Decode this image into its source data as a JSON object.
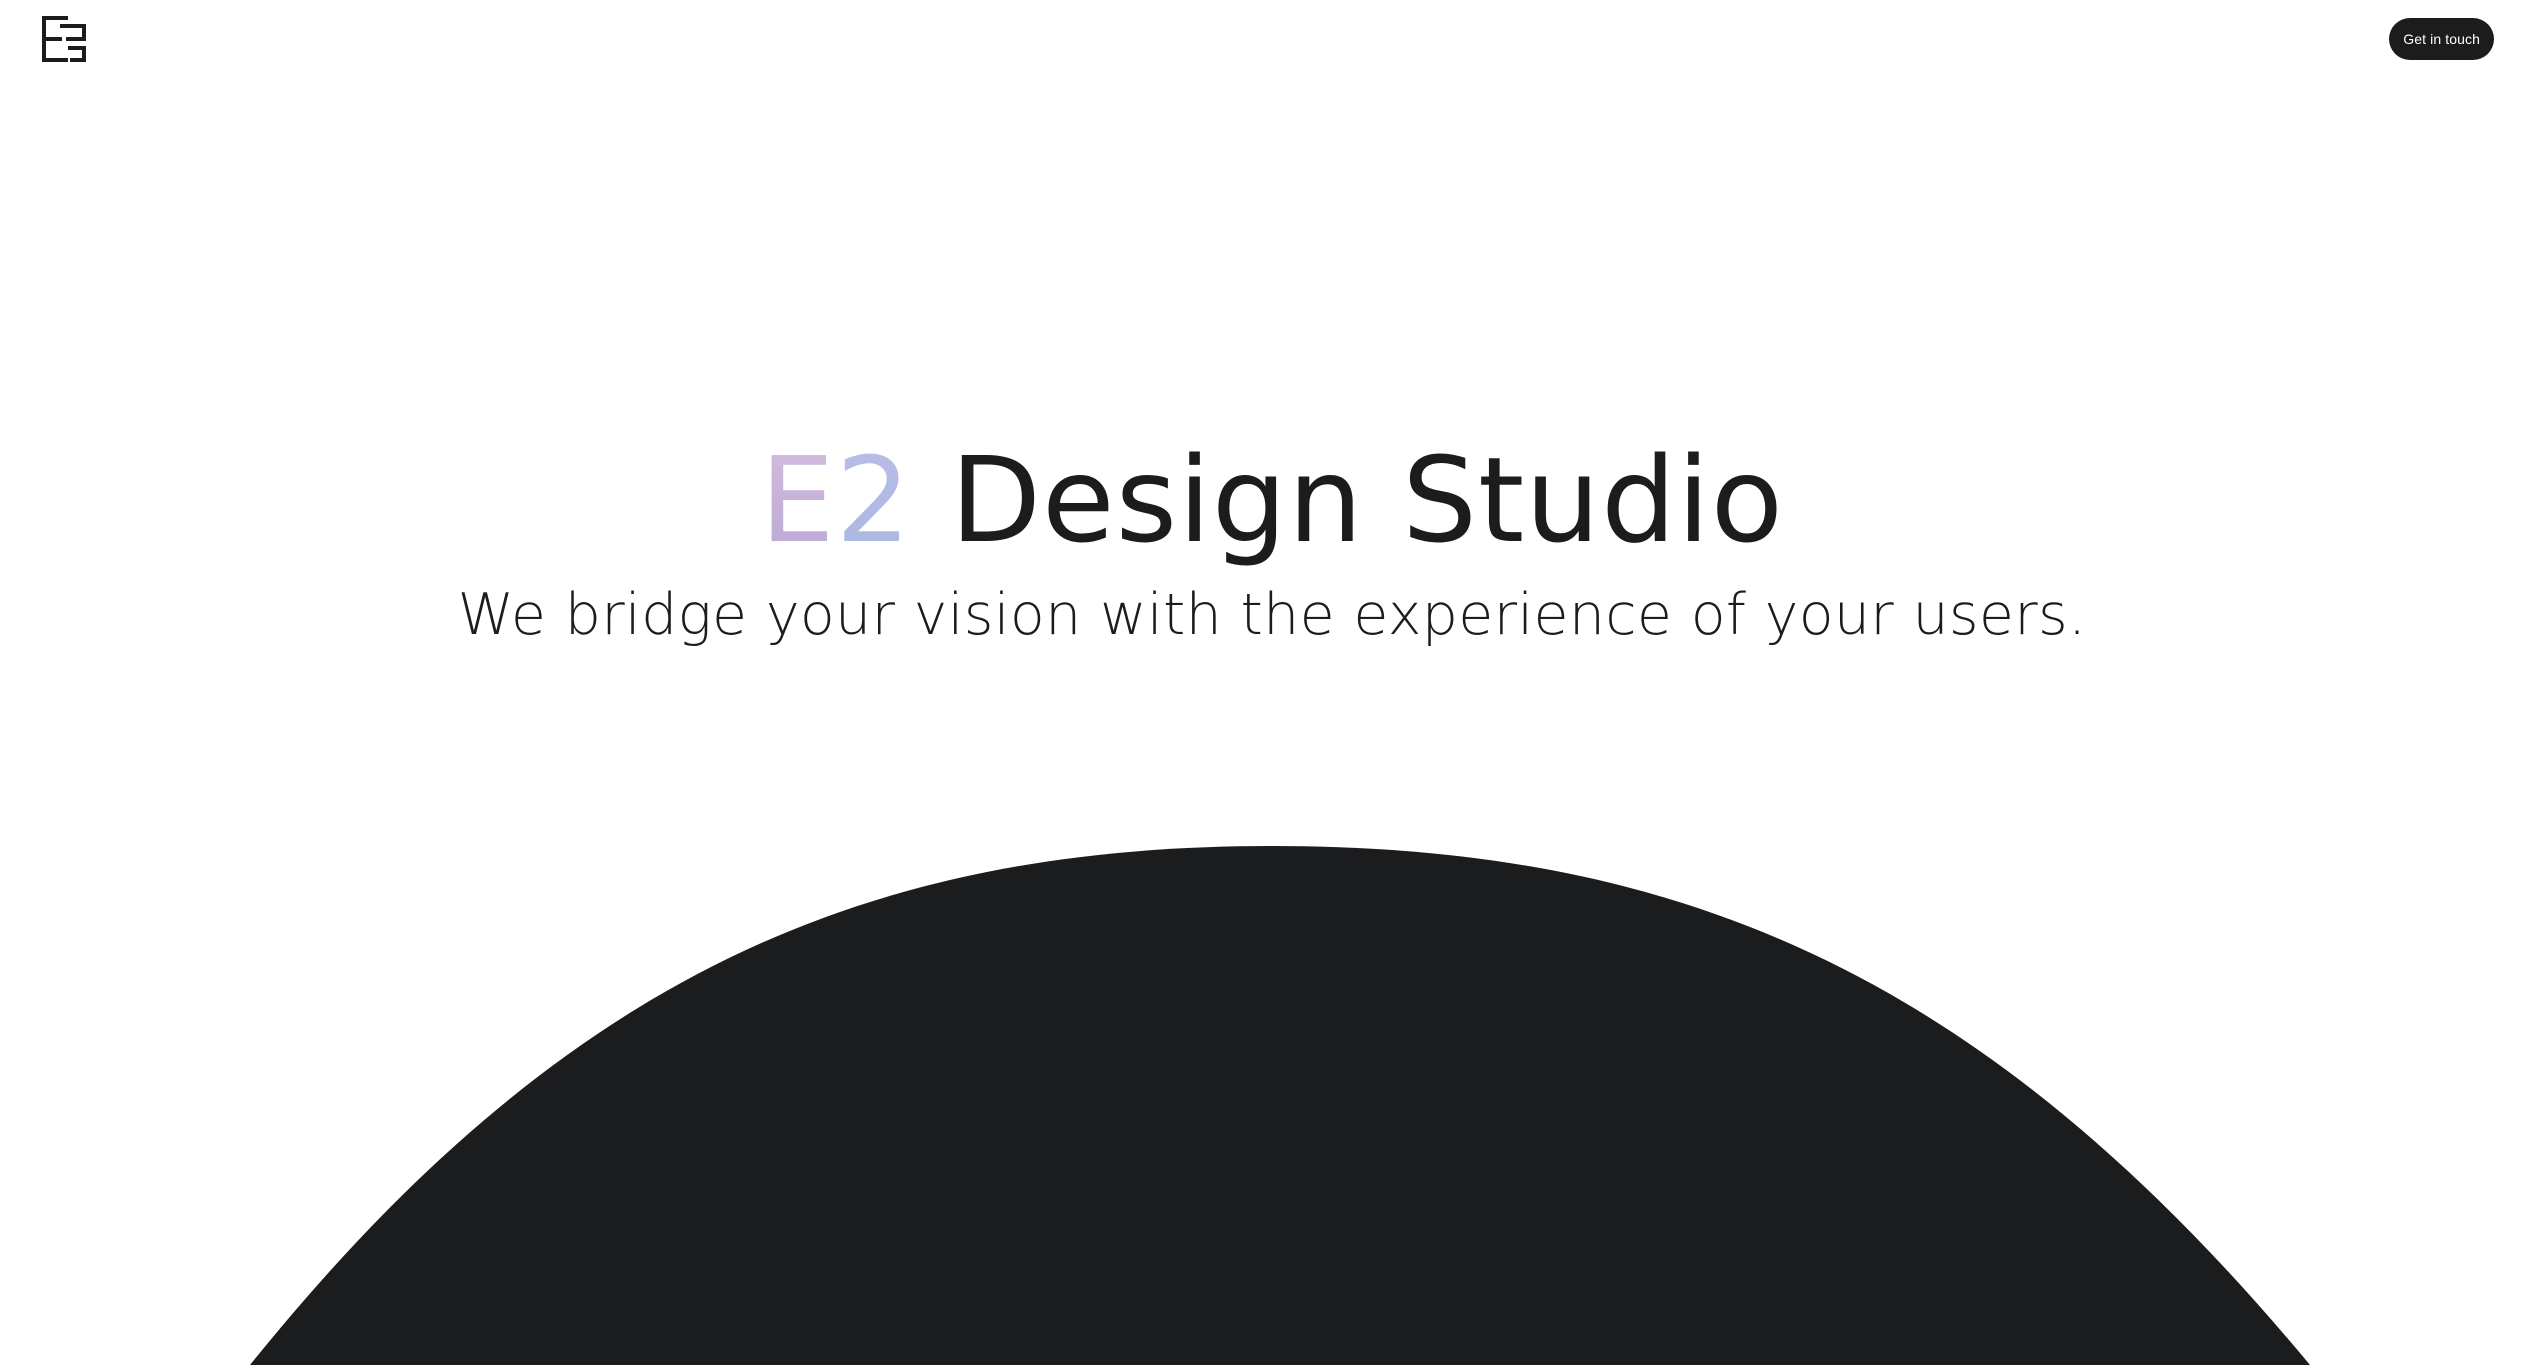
{
  "header": {
    "logo_icon": "e2-monogram-logo",
    "cta_label": "Get in touch"
  },
  "hero": {
    "brand_e": "E",
    "brand_2": "2",
    "title_rest": " Design Studio",
    "subtitle": "We bridge your vision with the experience of your users."
  },
  "colors": {
    "background": "#ffffff",
    "ink": "#1b1c1e",
    "brand_gradient_start": "#d4bddd",
    "brand_gradient_end": "#a9b8e2"
  }
}
